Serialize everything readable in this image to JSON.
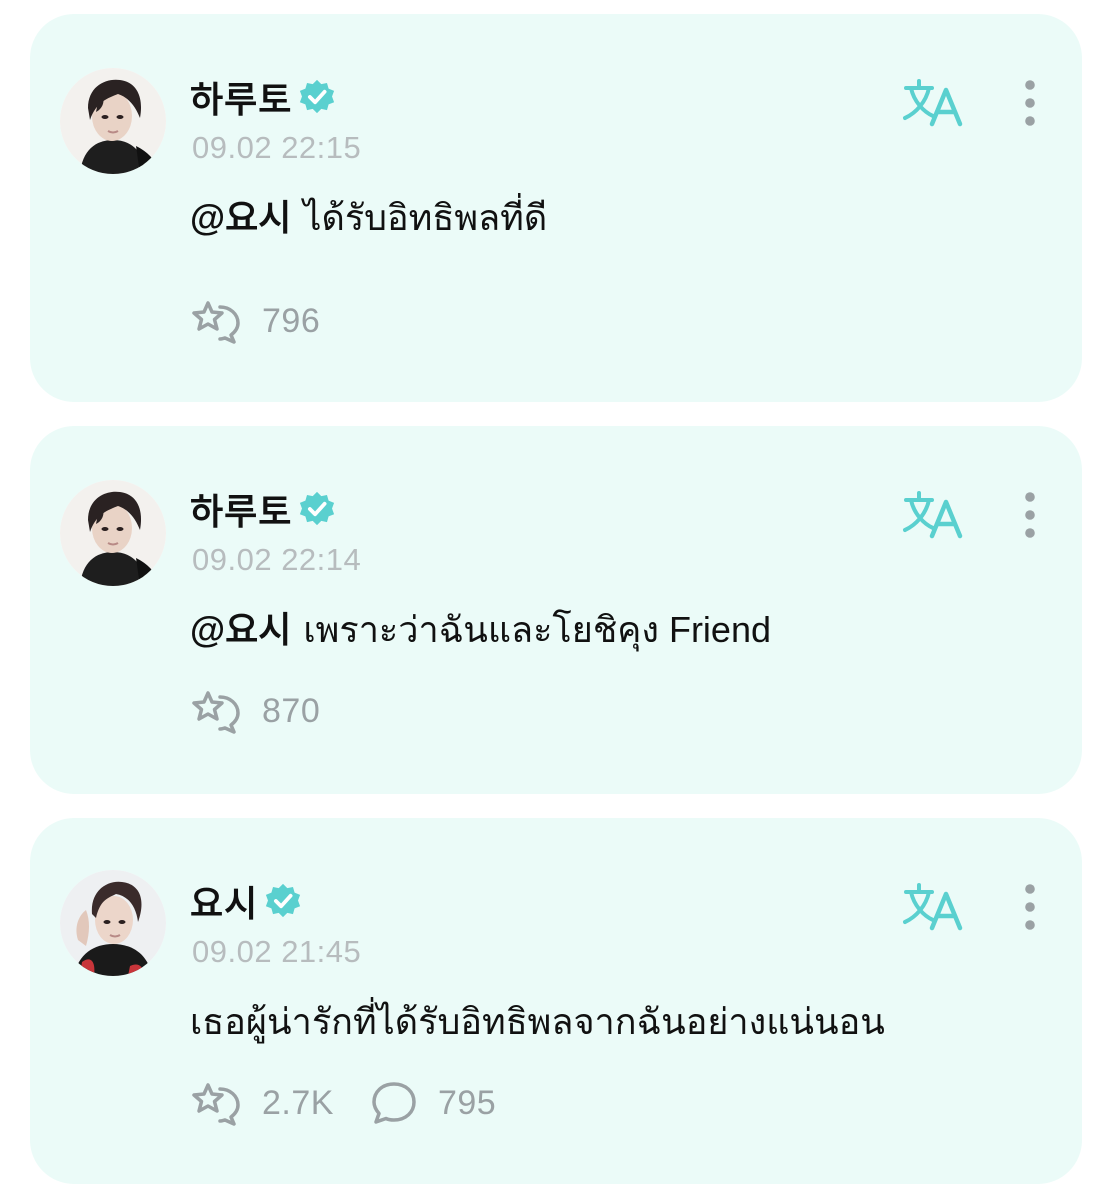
{
  "colors": {
    "card_background": "#ebfbf8",
    "accent_teal": "#5ad0cf",
    "timestamp_gray": "#b7bcbe",
    "icon_gray": "#9aa1a4"
  },
  "posts": [
    {
      "author": "하루토",
      "verified": true,
      "timestamp": "09.02 22:15",
      "mention": "@요시",
      "text": "ได้รับอิทธิพลที่ดี",
      "reactions": "796",
      "icons": [
        "reaction-icon",
        "translate-icon",
        "more-icon",
        "verified-badge-icon"
      ]
    },
    {
      "author": "하루토",
      "verified": true,
      "timestamp": "09.02 22:14",
      "mention": "@요시",
      "text": "เพราะว่าฉันและโยชิคุง Friend",
      "reactions": "870",
      "icons": [
        "reaction-icon",
        "translate-icon",
        "more-icon",
        "verified-badge-icon"
      ]
    },
    {
      "author": "요시",
      "verified": true,
      "timestamp": "09.02 21:45",
      "text": "เธอผู้น่ารักที่ได้รับอิทธิพลจากฉันอย่างแน่นอน",
      "reactions": "2.7K",
      "comments": "795",
      "icons": [
        "reaction-icon",
        "comment-icon",
        "translate-icon",
        "more-icon",
        "verified-badge-icon"
      ]
    }
  ]
}
